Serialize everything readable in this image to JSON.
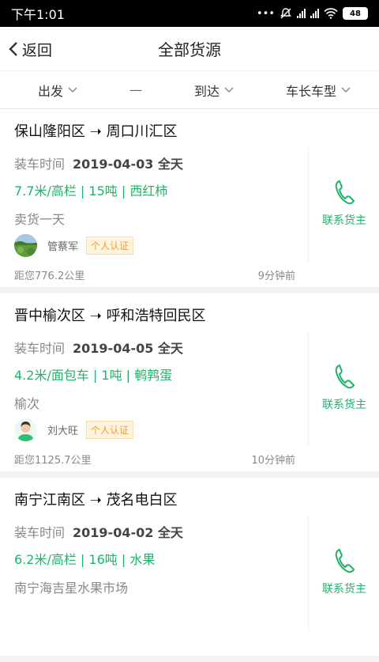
{
  "status": {
    "time": "下午1:01",
    "battery": "48"
  },
  "header": {
    "back_label": "返回",
    "title": "全部货源"
  },
  "filters": {
    "origin": "出发",
    "separator": "—",
    "destination": "到达",
    "vehicle": "车长车型"
  },
  "labels": {
    "load_time": "装车时间",
    "contact": "联系货主",
    "verified": "个人认证"
  },
  "colors": {
    "accent": "#1fb36a",
    "badge": "#f0a030"
  },
  "listings": [
    {
      "from": "保山隆阳区",
      "to": "周口川汇区",
      "arrow": "➝",
      "date": "2019-04-03 全天",
      "spec": "7.7米/高栏 | 15吨 | 西红柿",
      "desc": "卖货一天",
      "owner": "管蔡军",
      "distance": "距您776.2公里",
      "ago": "9分钟前"
    },
    {
      "from": "晋中榆次区",
      "to": "呼和浩特回民区",
      "arrow": "➝",
      "date": "2019-04-05 全天",
      "spec": "4.2米/面包车 | 1吨 | 鹌鹑蛋",
      "desc": "榆次",
      "owner": "刘大旺",
      "distance": "距您1125.7公里",
      "ago": "10分钟前"
    },
    {
      "from": "南宁江南区",
      "to": "茂名电白区",
      "arrow": "➝",
      "date": "2019-04-02 全天",
      "spec": "6.2米/高栏 | 16吨 | 水果",
      "desc": "南宁海吉星水果市场"
    }
  ]
}
